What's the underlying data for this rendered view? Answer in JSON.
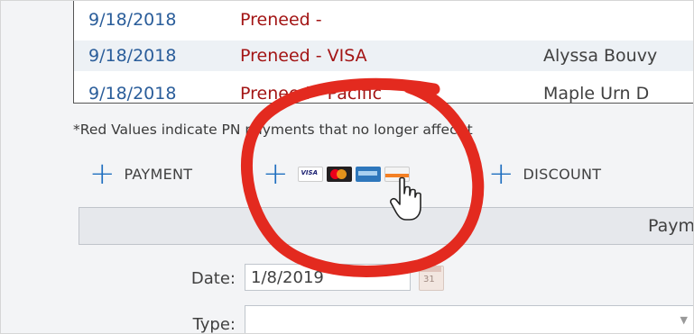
{
  "payments_table": {
    "rows": [
      {
        "date": "9/18/2018",
        "description": "Preneed -",
        "name": ""
      },
      {
        "date": "9/18/2018",
        "description": "Preneed - VISA",
        "name": "Alyssa Bouvy"
      },
      {
        "date": "9/18/2018",
        "description": "Preneed - Pacific",
        "name": "Maple Urn D"
      }
    ]
  },
  "note": "*Red Values indicate PN payments that no longer affect t",
  "actions": {
    "payment_label": "PAYMENT",
    "card_icons": [
      "visa-icon",
      "mastercard-icon",
      "amex-icon",
      "discover-icon"
    ],
    "discount_label": "DISCOUNT"
  },
  "payment_panel": {
    "header": "Paym",
    "date_label": "Date:",
    "date_value": "1/8/2019",
    "calendar_day": "31",
    "type_label": "Type:",
    "type_value": ""
  },
  "annotation": {
    "circle_color": "#e32a1f"
  }
}
